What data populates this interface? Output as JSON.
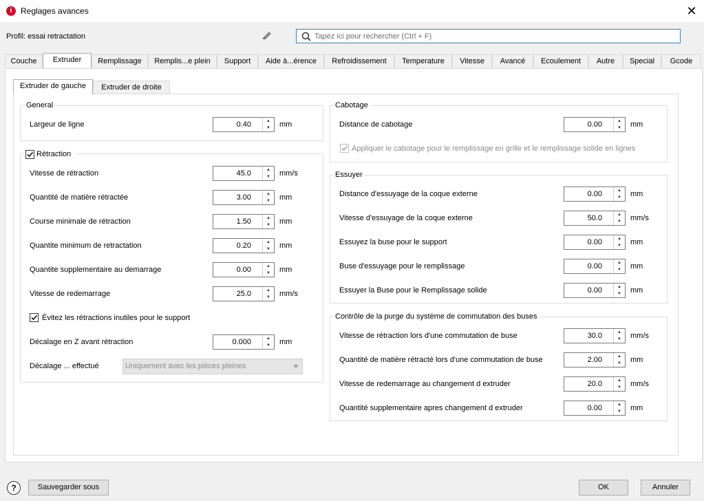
{
  "window": {
    "title": "Reglages avances",
    "app_icon_glyph": "i",
    "close_glyph": "✕"
  },
  "profile": {
    "label": "Profil: essai retractation"
  },
  "search": {
    "placeholder": "Tapez ici pour rechercher (Ctrl + F)",
    "value": ""
  },
  "tabs": [
    "Couche",
    "Extruder",
    "Remplissage",
    "Remplis...e plein",
    "Support",
    "Aide à...érence",
    "Refroidissement",
    "Temperature",
    "Vitesse",
    "Avancé",
    "Ecoulement",
    "Autre",
    "Special",
    "Gcode"
  ],
  "active_tab": "Extruder",
  "subtabs": [
    "Extruder de gauche",
    "Extruder de droite"
  ],
  "active_subtab": "Extruder de gauche",
  "general": {
    "title": "General",
    "line_width": {
      "label": "Largeur de ligne",
      "value": "0.40",
      "unit": "mm"
    }
  },
  "retraction": {
    "title": "Rétraction",
    "checked": true,
    "fields": [
      {
        "label": "Vitesse de rétraction",
        "value": "45.0",
        "unit": "mm/s"
      },
      {
        "label": "Quantité de matière rétractée",
        "value": "3.00",
        "unit": "mm"
      },
      {
        "label": "Course minimale de rétraction",
        "value": "1.50",
        "unit": "mm"
      },
      {
        "label": "Quantite minimum de retractation",
        "value": "0.20",
        "unit": "mm"
      },
      {
        "label": "Quantite supplementaire au demarrage",
        "value": "0.00",
        "unit": "mm"
      },
      {
        "label": "Vitesse de redemarrage",
        "value": "25.0",
        "unit": "mm/s"
      }
    ],
    "avoid_support": {
      "label": "Évitez les rétractions inutiles pour le support",
      "checked": true
    },
    "z_offset": {
      "label": "Décalage en Z avant rétraction",
      "value": "0.000",
      "unit": "mm"
    },
    "offset_done": {
      "label": "Décalage ... effectué",
      "value": "Uniquement avec les pièces pleines"
    }
  },
  "cabotage": {
    "title": "Cabotage",
    "distance": {
      "label": "Distance de cabotage",
      "value": "0.00",
      "unit": "mm"
    },
    "apply": {
      "label": "Appliquer le cabotage pour le remplissage en grille et le remplissage solide en lignes",
      "checked": true
    }
  },
  "essuyer": {
    "title": "Essuyer",
    "fields": [
      {
        "label": "Distance d'essuyage de la coque externe",
        "value": "0.00",
        "unit": "mm"
      },
      {
        "label": "Vitesse d'essuyage de la coque externe",
        "value": "50.0",
        "unit": "mm/s"
      },
      {
        "label": "Essuyez la buse pour le support",
        "value": "0.00",
        "unit": "mm"
      },
      {
        "label": "Buse d'essuyage pour le remplissage",
        "value": "0.00",
        "unit": "mm"
      },
      {
        "label": "Essuyer la Buse pour le Remplissage solide",
        "value": "0.00",
        "unit": "mm"
      }
    ]
  },
  "purge": {
    "title": "Contrôle de la purge du système de commutation des buses",
    "fields": [
      {
        "label": "Vitesse de rétraction lors d'une commutation de buse",
        "value": "30.0",
        "unit": "mm/s"
      },
      {
        "label": "Quantité de matière rétracté lors d'une commutation de buse",
        "value": "2.00",
        "unit": "mm"
      },
      {
        "label": "Vitesse de redemarrage au changement d extruder",
        "value": "20.0",
        "unit": "mm/s"
      },
      {
        "label": "Quantité supplementaire apres changement d extruder",
        "value": "0.00",
        "unit": "mm"
      }
    ]
  },
  "buttons": {
    "help_glyph": "?",
    "save_as": "Sauvegarder sous",
    "ok": "OK",
    "cancel": "Annuler"
  },
  "colors": {
    "accent": "#3c7fb1",
    "brand": "#c8102e",
    "panel": "#ffffff",
    "background": "#f0f0f0"
  }
}
